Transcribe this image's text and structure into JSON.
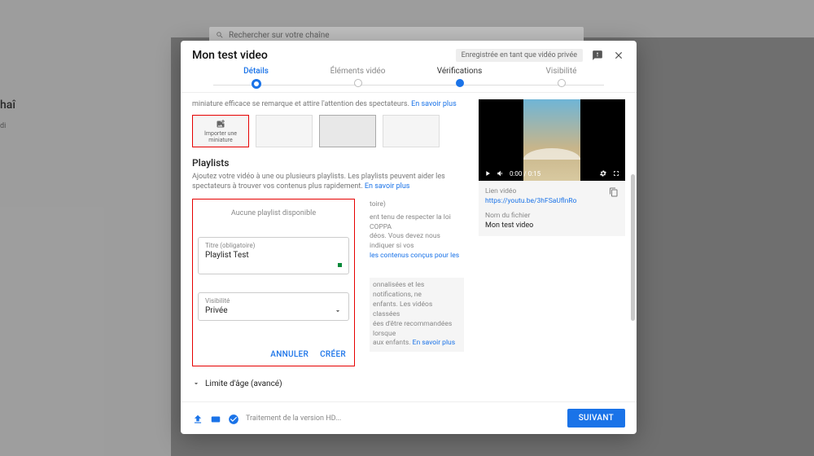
{
  "bg": {
    "search_placeholder": "Rechercher sur votre chaîne",
    "side_hai": "haî",
    "side_di": "di"
  },
  "modal": {
    "title": "Mon test video",
    "save_badge": "Enregistrée en tant que vidéo privée",
    "steps": {
      "details": "Détails",
      "elements": "Éléments vidéo",
      "checks": "Vérifications",
      "visibility": "Visibilité"
    },
    "thumb": {
      "hint": "miniature efficace se remarque et attire l'attention des spectateurs.",
      "learn": "En savoir plus",
      "import": "Importer une miniature"
    },
    "playlists": {
      "heading": "Playlists",
      "hint": "Ajoutez votre vidéo à une ou plusieurs playlists. Les playlists peuvent aider les spectateurs à trouver vos contenus plus rapidement.",
      "learn": "En savoir plus",
      "empty": "Aucune playlist disponible",
      "title_label": "Titre (obligatoire)",
      "title_value": "Playlist Test",
      "vis_label": "Visibilité",
      "vis_value": "Privée",
      "required_suffix": "toire)",
      "cancel": "ANNULER",
      "create": "CRÉER"
    },
    "sideinfo": {
      "line1": "ent tenu de respecter la loi COPPA",
      "line2": "déos. Vous devez nous indiquer si vos",
      "link1": "les contenus conçus pour les",
      "line3": "onnalisées et les notifications, ne",
      "line4": "enfants. Les vidéos classées",
      "line5": "ées d'être recommandées lorsque",
      "line6": "aux enfants.",
      "link2": "En savoir plus"
    },
    "age": "Limite d'âge (avancé)",
    "video": {
      "time": "0:00 / 0:15",
      "link_label": "Lien vidéo",
      "link_value": "https://youtu.be/3hFSaUflnRo",
      "file_label": "Nom du fichier",
      "file_value": "Mon test video"
    },
    "footer": {
      "processing": "Traitement de la version HD...",
      "next": "SUIVANT"
    }
  }
}
